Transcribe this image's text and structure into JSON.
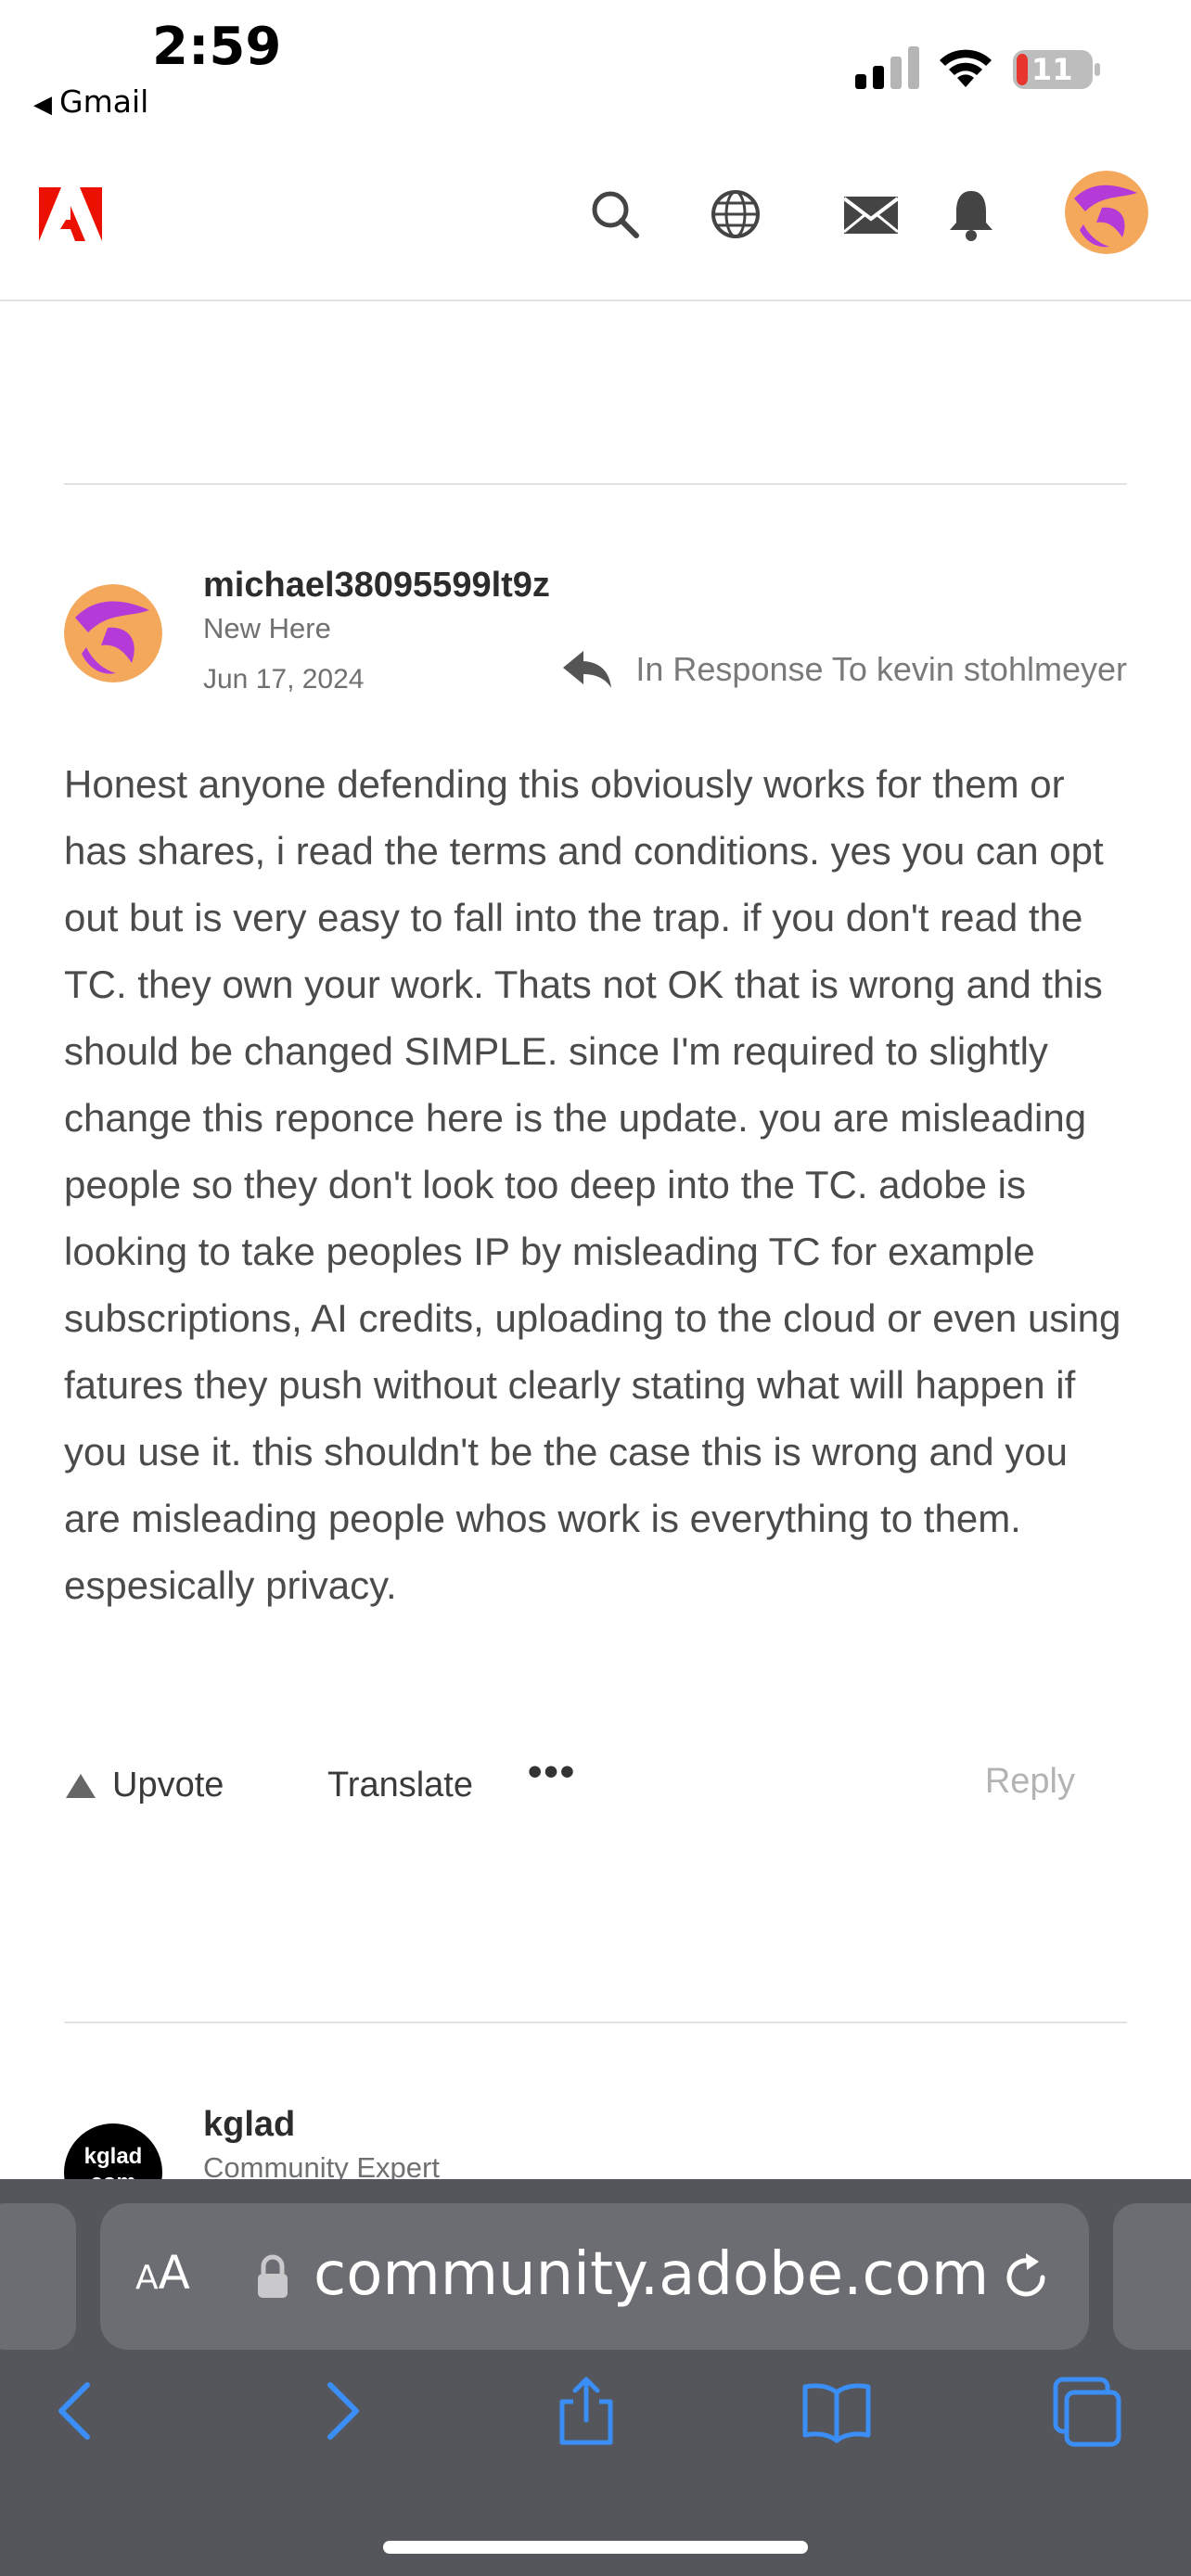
{
  "status": {
    "time": "2:59",
    "back_app": "Gmail",
    "battery": "11"
  },
  "header": {
    "logo": "adobe-logo",
    "icons": [
      "search-icon",
      "globe-icon",
      "mail-icon",
      "bell-icon"
    ]
  },
  "post": {
    "username": "michael38095599lt9z",
    "rank": "New Here",
    "date": "Jun 17, 2024",
    "in_response": "In Response To kevin stohlmeyer",
    "body": "Honest anyone defending this obviously works for them or has shares, i read the terms and conditions. yes you can opt out but is very easy to fall into the trap. if you don't read the TC. they own your work. Thats not OK that is wrong and this should be changed SIMPLE. since I'm required to slightly change this reponce here is the update. you are misleading people so they don't look too deep into the TC. adobe is looking to take peoples IP by misleading TC for example subscriptions, AI credits,  uploading to the cloud or even using fatures they push without clearly stating what will happen if you use it. this shouldn't be the case this is wrong and you are misleading people whos work is everything to them. espesically privacy.",
    "actions": {
      "upvote": "Upvote",
      "translate": "Translate",
      "more": "•••",
      "reply": "Reply"
    }
  },
  "next_post": {
    "username": "kglad",
    "rank": "Community Expert",
    "avatar_text": "kglad com"
  },
  "safari": {
    "aa_small": "A",
    "aa_large": "A",
    "url": "community.adobe.com"
  },
  "colors": {
    "adobe_red": "#eb1000",
    "accent_blue": "#3a8ef6",
    "safari_bar": "#54565b"
  }
}
